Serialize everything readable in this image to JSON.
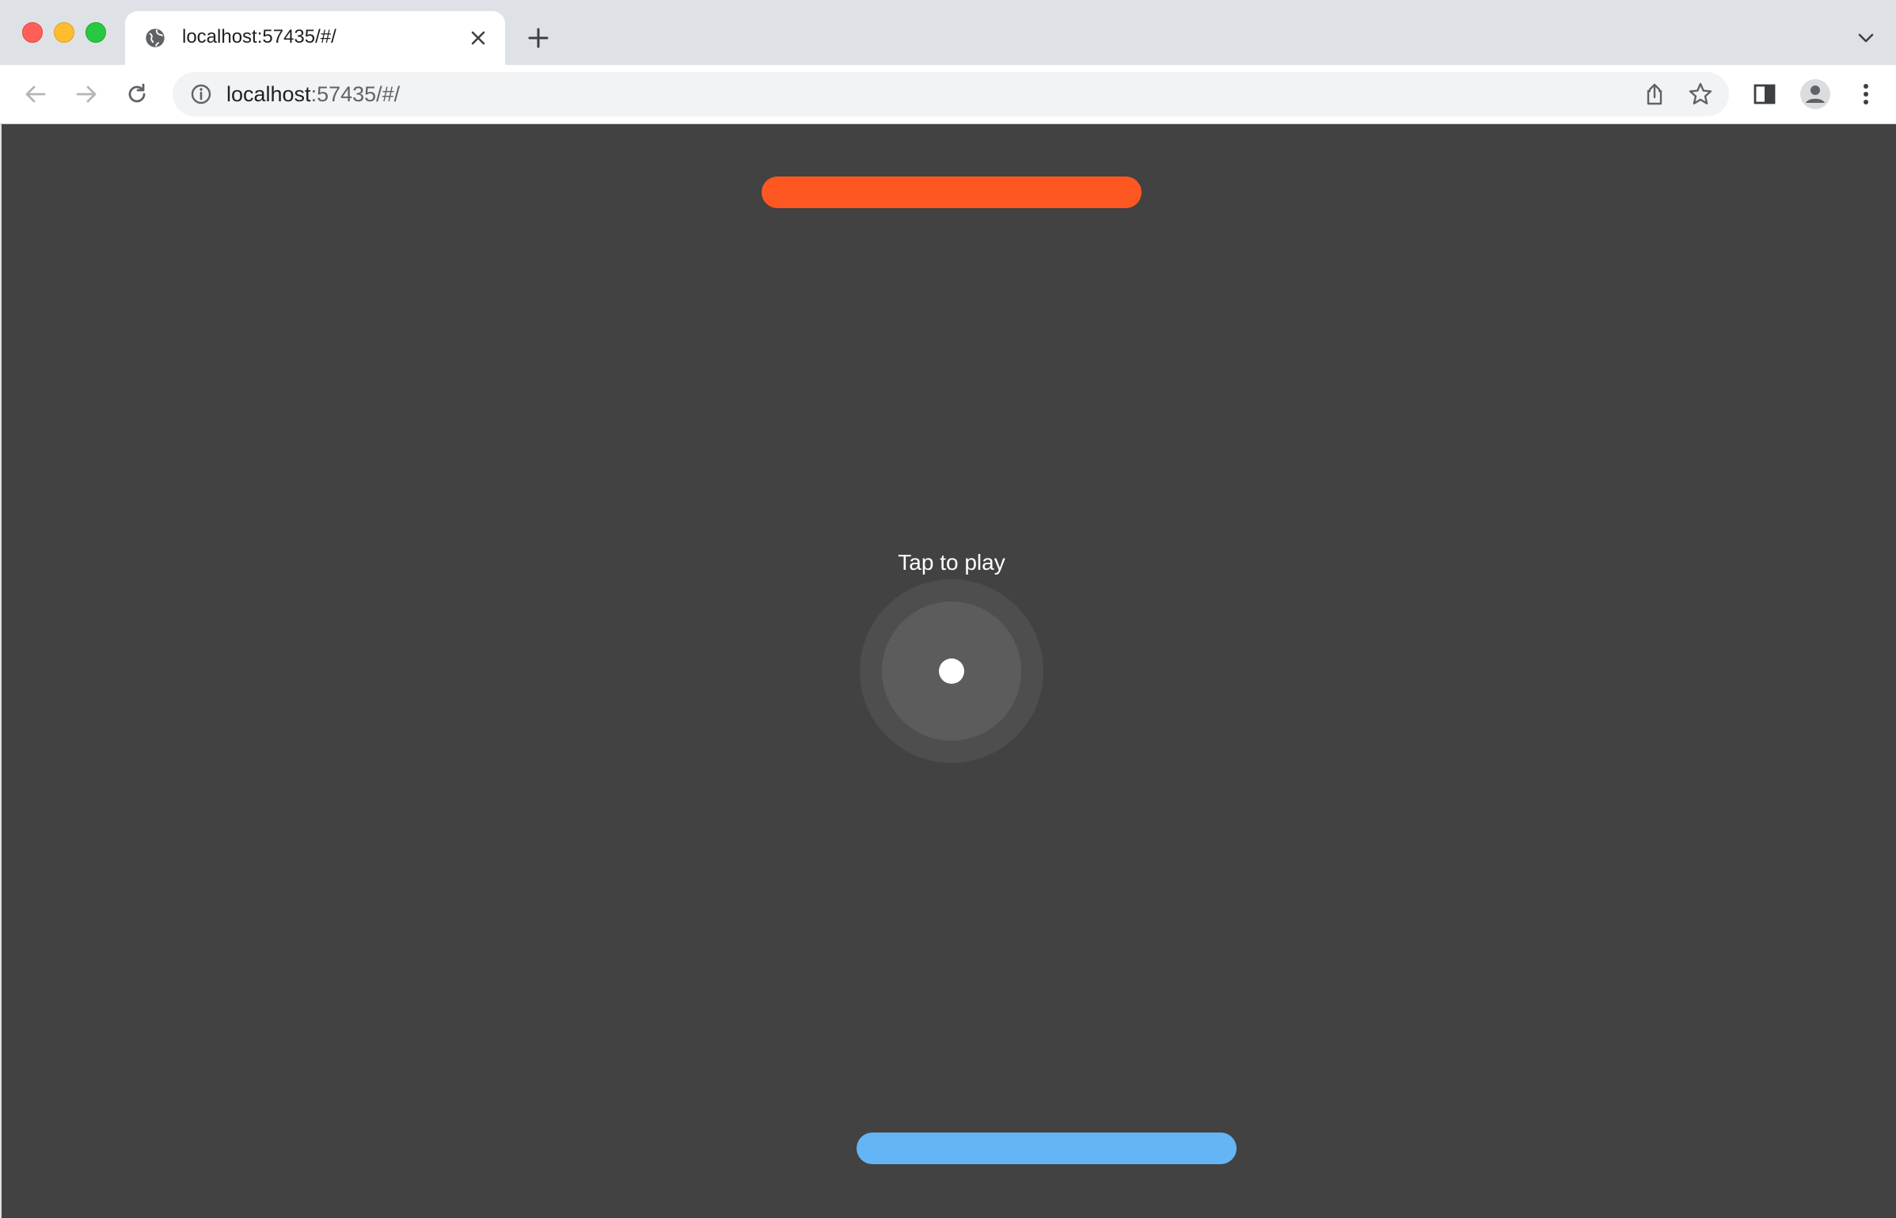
{
  "browser": {
    "tab": {
      "title": "localhost:57435/#/",
      "favicon": "globe-icon",
      "close_icon": "close-icon"
    },
    "new_tab_icon": "plus-icon",
    "tab_search_icon": "chevron-down-icon",
    "toolbar": {
      "back_icon": "arrow-left-icon",
      "forward_icon": "arrow-right-icon",
      "reload_icon": "reload-icon",
      "site_info_icon": "info-icon",
      "url_host": "localhost",
      "url_rest": ":57435/#/",
      "share_icon": "share-icon",
      "bookmark_icon": "star-icon",
      "side_panel_icon": "side-panel-icon",
      "profile_icon": "avatar-icon",
      "menu_icon": "more-vertical-icon"
    }
  },
  "game": {
    "prompt": "Tap to play",
    "colors": {
      "background": "#424242",
      "top_paddle": "#ff5722",
      "bottom_paddle": "#64b5f6",
      "ball": "#ffffff"
    }
  }
}
